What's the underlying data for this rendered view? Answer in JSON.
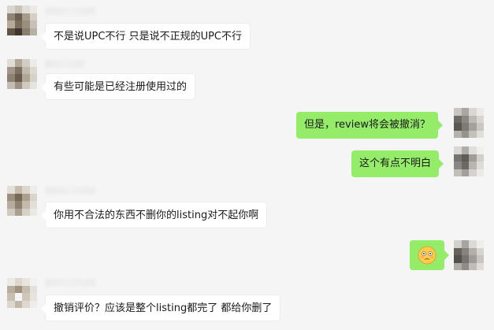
{
  "messages": [
    {
      "side": "in",
      "text": "不是说UPC不行 只是说不正规的UPC不行"
    },
    {
      "side": "in",
      "text": "有些可能是已经注册使用过的"
    },
    {
      "side": "out",
      "text": "但是，review将会被撤消？"
    },
    {
      "side": "out",
      "text": "这个有点不明白"
    },
    {
      "side": "in",
      "text": "你用不合法的东西不删你的listing对不起你啊"
    },
    {
      "side": "out",
      "emoji": "flushed-face"
    },
    {
      "side": "in",
      "text": "撤销评价？应该是整个listing都完了  都给你删了"
    }
  ],
  "colors": {
    "background": "#f5f5f5",
    "incoming_bubble": "#ffffff",
    "outgoing_bubble": "#95ec69"
  }
}
